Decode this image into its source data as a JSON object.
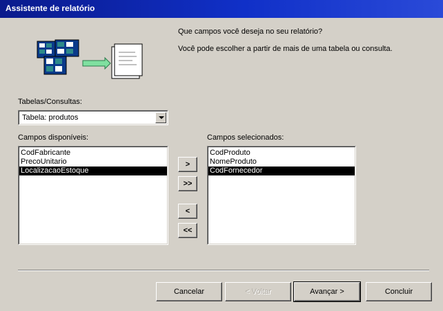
{
  "window": {
    "title": "Assistente de relatório"
  },
  "intro": {
    "question": "Que campos você deseja no seu relatório?",
    "hint": "Você pode escolher a partir de mais de uma tabela ou consulta."
  },
  "tables": {
    "label": "Tabelas/Consultas:",
    "selected": "Tabela: produtos"
  },
  "available": {
    "label": "Campos disponíveis:",
    "items": [
      "CodFabricante",
      "PrecoUnitario",
      "LocalizacaoEstoque"
    ],
    "selected_index": 2
  },
  "selected_fields": {
    "label": "Campos selecionados:",
    "items": [
      "CodProduto",
      "NomeProduto",
      "CodFornecedor"
    ],
    "selected_index": 2
  },
  "move_buttons": {
    "add_one": ">",
    "add_all": ">>",
    "remove_one": "<",
    "remove_all": "<<"
  },
  "footer": {
    "cancel": "Cancelar",
    "back": "< Voltar",
    "next": "Avançar >",
    "finish": "Concluir"
  }
}
